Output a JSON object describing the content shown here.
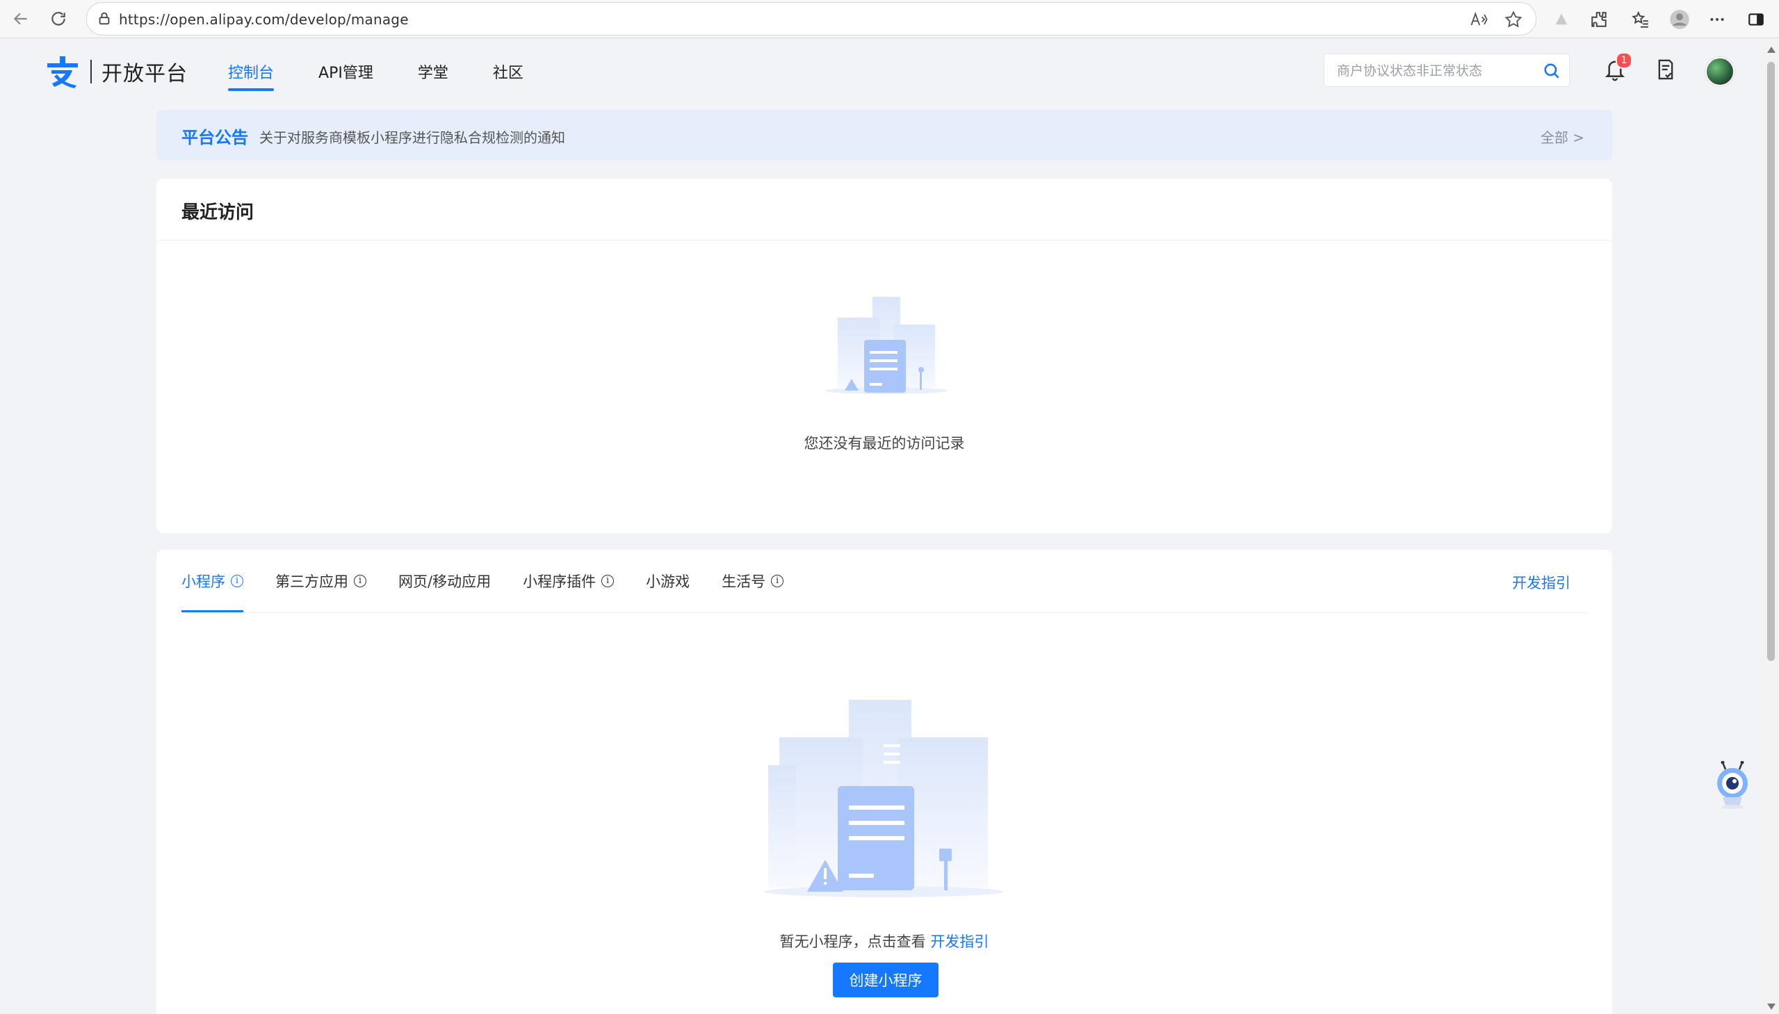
{
  "browser": {
    "url": "https://open.alipay.com/develop/manage"
  },
  "header": {
    "brand": "开放平台",
    "menu": [
      {
        "label": "控制台",
        "active": true
      },
      {
        "label": "API管理",
        "active": false
      },
      {
        "label": "学堂",
        "active": false
      },
      {
        "label": "社区",
        "active": false
      }
    ],
    "search_placeholder": "商户协议状态非正常状态",
    "notification_count": "1"
  },
  "notice": {
    "tag": "平台公告",
    "message": "关于对服务商模板小程序进行隐私合规检测的通知",
    "all_link": "全部 >"
  },
  "recent": {
    "title": "最近访问",
    "empty_text": "您还没有最近的访问记录"
  },
  "apps": {
    "tabs": [
      {
        "label": "小程序",
        "info": true,
        "active": true
      },
      {
        "label": "第三方应用",
        "info": true,
        "active": false
      },
      {
        "label": "网页/移动应用",
        "info": false,
        "active": false
      },
      {
        "label": "小程序插件",
        "info": true,
        "active": false
      },
      {
        "label": "小游戏",
        "info": false,
        "active": false
      },
      {
        "label": "生活号",
        "info": true,
        "active": false
      }
    ],
    "dev_guide": "开发指引",
    "empty_text": "暂无小程序，点击查看",
    "empty_link": "开发指引",
    "create_button": "创建小程序"
  },
  "colors": {
    "primary": "#1677ff",
    "badge": "#ff4d4f",
    "page_bg": "#f1f3f6",
    "notice_bg": "#e6eefb"
  }
}
